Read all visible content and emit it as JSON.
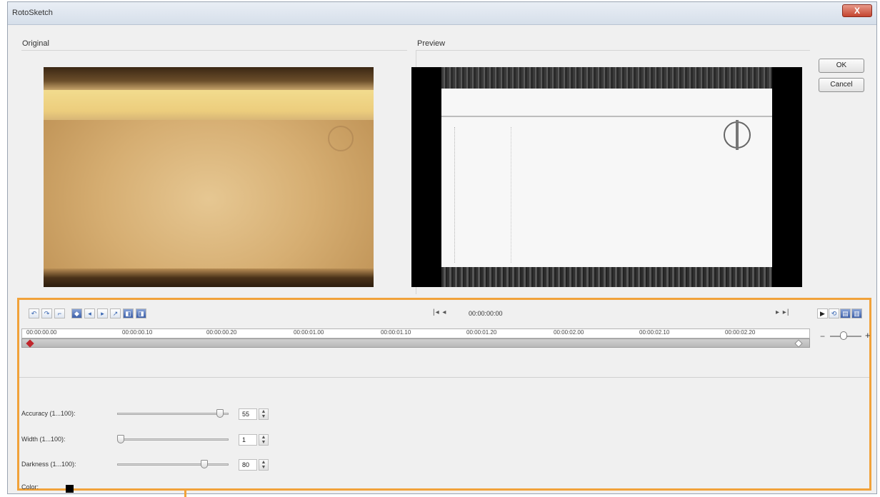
{
  "window": {
    "title": "RotoSketch",
    "close_label": "X"
  },
  "panes": {
    "original_label": "Original",
    "preview_label": "Preview"
  },
  "buttons": {
    "ok": "OK",
    "cancel": "Cancel"
  },
  "toolbar": {
    "tools": [
      "add-keyframe-icon",
      "remove-keyframe-icon",
      "reverse-keyframe-icon",
      "goto-prev-keyframe-icon",
      "goto-first-keyframe-icon",
      "goto-next-keyframe-icon",
      "goto-last-keyframe-icon",
      "copy-keyframe-icon",
      "paste-keyframe-icon"
    ],
    "nav_left": "|◂ ◂",
    "timecode": "00:00:00:00",
    "nav_right": "▸ ▸|"
  },
  "timeline": {
    "ticks": [
      "00:00:00.00",
      "00:00:00.10",
      "00:00:00.20",
      "00:00:01.00",
      "00:00:01.10",
      "00:00:01.20",
      "00:00:02.00",
      "00:00:02.10",
      "00:00:02.20"
    ],
    "zoom_minus": "−",
    "zoom_plus": "+"
  },
  "params": {
    "accuracy": {
      "label": "Accuracy (1...100):",
      "value": "55",
      "level": 0.95
    },
    "width": {
      "label": "Width (1...100):",
      "value": "1",
      "level": 0.0
    },
    "darkness": {
      "label": "Darkness (1...100):",
      "value": "80",
      "level": 0.8
    },
    "color": {
      "label": "Color:",
      "value": "#000000"
    }
  },
  "colors": {
    "highlight": "#f1a23a",
    "keyframe": "#c0262c"
  }
}
